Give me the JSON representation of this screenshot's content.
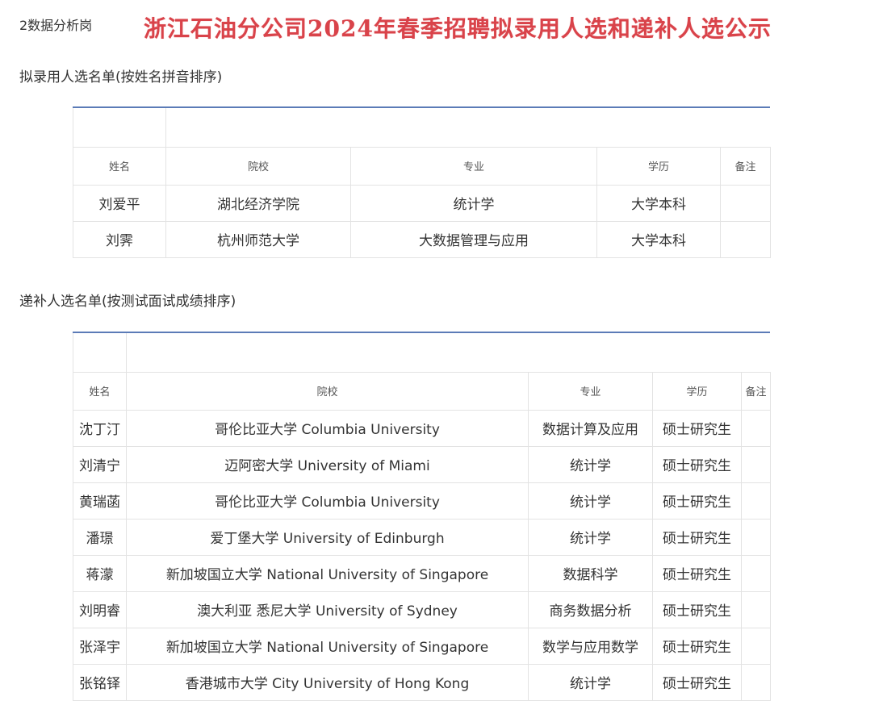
{
  "post_label": "2数据分析岗",
  "title": "浙江石油分公司2024年春季招聘拟录用人选和递补人选公示",
  "section1": {
    "title": "拟录用人选名单(按姓名拼音排序)",
    "headers": [
      "姓名",
      "院校",
      "专业",
      "学历",
      "备注"
    ],
    "rows": [
      [
        "刘爱平",
        "湖北经济学院",
        "统计学",
        "大学本科",
        ""
      ],
      [
        "刘霁",
        "杭州师范大学",
        "大数据管理与应用",
        "大学本科",
        ""
      ]
    ]
  },
  "section2": {
    "title": "递补人选名单(按测试面试成绩排序)",
    "headers": [
      "姓名",
      "院校",
      "专业",
      "学历",
      "备注"
    ],
    "rows": [
      [
        "沈丁汀",
        "哥伦比亚大学 Columbia University",
        "数据计算及应用",
        "硕士研究生",
        ""
      ],
      [
        "刘清宁",
        "迈阿密大学 University of Miami",
        "统计学",
        "硕士研究生",
        ""
      ],
      [
        "黄瑞菡",
        "哥伦比亚大学 Columbia University",
        "统计学",
        "硕士研究生",
        ""
      ],
      [
        "潘璟",
        "爱丁堡大学 University of Edinburgh",
        "统计学",
        "硕士研究生",
        ""
      ],
      [
        "蒋濛",
        "新加坡国立大学 National University of Singapore",
        "数据科学",
        "硕士研究生",
        ""
      ],
      [
        "刘明睿",
        "澳大利亚 悉尼大学 University of Sydney",
        "商务数据分析",
        "硕士研究生",
        ""
      ],
      [
        "张泽宇",
        "新加坡国立大学 National University of Singapore",
        "数学与应用数学",
        "硕士研究生",
        ""
      ],
      [
        "张铭铎",
        "香港城市大学 City University of Hong Kong",
        "统计学",
        "硕士研究生",
        ""
      ]
    ]
  }
}
